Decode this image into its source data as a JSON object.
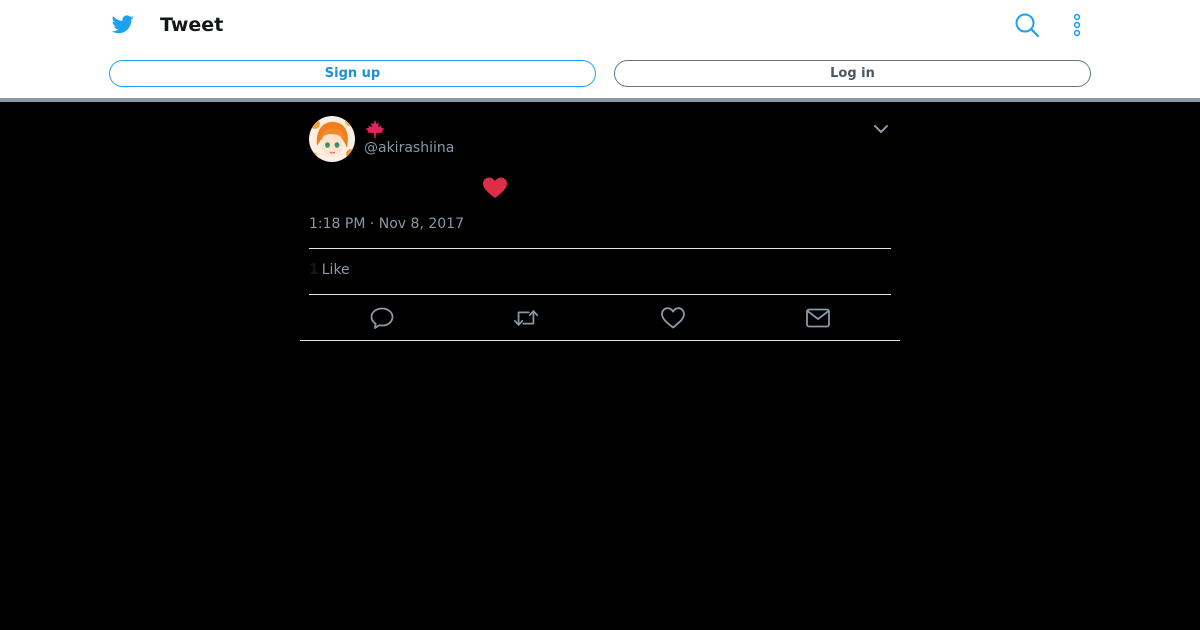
{
  "header": {
    "title": "Tweet",
    "logo_icon": "twitter-bird-icon",
    "search_icon": "search-icon",
    "more_icon": "more-vertical-icon",
    "signup_label": "Sign up",
    "login_label": "Log in"
  },
  "tweet": {
    "avatar_icon": "avatar-image",
    "display_name_icon": "maple-leaf-emoji",
    "handle": "@akirashiina",
    "caret_icon": "chevron-down-icon",
    "content_icon": "red-heart-emoji",
    "timestamp": "1:18 PM · Nov 8, 2017",
    "likes": {
      "count": "1",
      "label": "Like"
    },
    "actions": {
      "reply_icon": "reply-icon",
      "retweet_icon": "retweet-icon",
      "like_icon": "heart-outline-icon",
      "dm_icon": "envelope-icon"
    }
  },
  "colors": {
    "brand_blue": "#1da1f2",
    "background": "#000000",
    "muted_text": "#8899a6",
    "emoji_red": "#e0245e"
  }
}
